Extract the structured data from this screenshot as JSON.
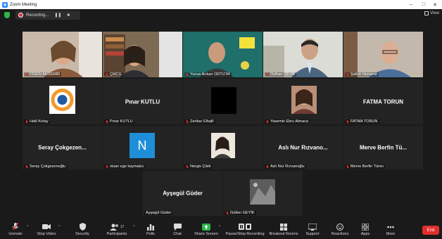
{
  "window": {
    "title": "Zoom Meeting",
    "minimize": "–",
    "maximize": "□",
    "close": "✕"
  },
  "topbar": {
    "recording_label": "Recording...",
    "pause_label": "❚❚",
    "stop_label": "■",
    "view_label": "View"
  },
  "participants": [
    {
      "name": "FİGEN AKDEMİR",
      "muted": true,
      "kind": "video"
    },
    {
      "name": "ÇMCG",
      "muted": true,
      "kind": "video"
    },
    {
      "name": "Yunus Arıkan ODTU'94",
      "muted": true,
      "kind": "video"
    },
    {
      "name": "Özlhan ÇEVİK",
      "muted": true,
      "kind": "video",
      "active": true
    },
    {
      "name": "Şafiyh Hemarat",
      "muted": true,
      "kind": "video"
    },
    {
      "name": "Helil Kırtay",
      "muted": true,
      "kind": "logo"
    },
    {
      "name": "Pınar KUTLU",
      "muted": true,
      "kind": "text",
      "display": "Pınar KUTLU"
    },
    {
      "name": "Zeribar Elhalil",
      "muted": true,
      "kind": "black"
    },
    {
      "name": "Yasemin Ebru Atmaca",
      "muted": true,
      "kind": "photo"
    },
    {
      "name": "FATMA TORUN",
      "muted": true,
      "kind": "text",
      "display": "FATMA TORUN"
    },
    {
      "name": "Seray Çokgezenoğlu",
      "muted": true,
      "kind": "text",
      "display": "Seray  Çokgezen..."
    },
    {
      "name": "nisan ege kaymakcı",
      "muted": true,
      "kind": "letter",
      "display": "N"
    },
    {
      "name": "Nergis Çilek",
      "muted": true,
      "kind": "photo2"
    },
    {
      "name": "Aslı Nur Rızvanoğlu",
      "muted": true,
      "kind": "text",
      "display": "Aslı Nur Rızvano..."
    },
    {
      "name": "Merve Berfin Türen",
      "muted": true,
      "kind": "text",
      "display": "Merve Berfin Tü..."
    },
    {
      "name": "Ayşegül Güder",
      "muted": false,
      "kind": "text",
      "display": "Ayşegül Güder"
    },
    {
      "name": "Gülten GEYİK",
      "muted": true,
      "kind": "photo3"
    }
  ],
  "toolbar": {
    "unmute": "Unmute",
    "stop_video": "Stop Video",
    "security": "Security",
    "participants": "Participants",
    "participants_count": "17",
    "polls": "Polls",
    "chat": "Chat",
    "share_screen": "Share Screen",
    "pause_recording": "Pause/Stop Recording",
    "breakout_rooms": "Breakout Rooms",
    "support": "Support",
    "reactions": "Reactions",
    "apps": "Apps",
    "more": "More",
    "end": "End"
  },
  "colors": {
    "accent": "#2d8cff",
    "active_border": "#b7e23a",
    "end": "#e02e2e",
    "share": "#2fb34a"
  }
}
